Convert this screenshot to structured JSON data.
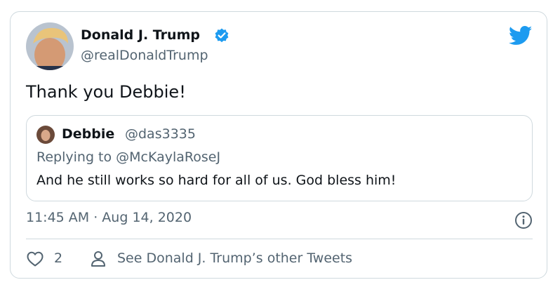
{
  "tweet": {
    "author_name": "Donald J. Trump",
    "author_handle": "@realDonaldTrump",
    "text": "Thank you Debbie!",
    "timestamp": "11:45 AM · Aug 14, 2020",
    "like_count": "2",
    "other_tweets_label": "See Donald J. Trump’s other Tweets"
  },
  "quoted": {
    "author_name": "Debbie",
    "author_handle": "@das3335",
    "replying_to": "Replying to @McKaylaRoseJ",
    "text": "And he still works so hard for all of us. God bless him!"
  },
  "icons": {
    "brand": "twitter-bird-icon",
    "verified": "verified-badge-icon",
    "info": "info-icon",
    "like": "heart-icon",
    "profile": "person-icon"
  },
  "colors": {
    "brand_blue": "#1d9bf0",
    "text_primary": "#0f1419",
    "text_secondary": "#536471",
    "border": "#cfd9de"
  }
}
